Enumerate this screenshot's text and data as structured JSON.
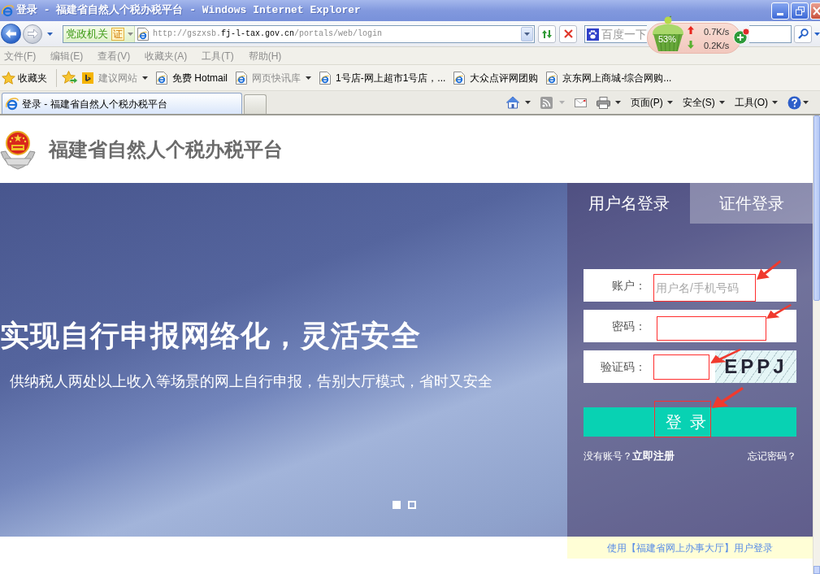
{
  "window": {
    "title": "登录 - 福建省自然人个税办税平台 - Windows Internet Explorer"
  },
  "address_bar": {
    "zone_label": "党政机关",
    "zone_badge": "证",
    "url_start": "http://gszxsb.",
    "url_domain": "fj-l-tax.gov.cn",
    "url_path": "/portals/web/login"
  },
  "search": {
    "placeholder": "百度一下"
  },
  "net_monitor": {
    "percent": "53%",
    "upload": "0.7K/s",
    "download": "0.2K/s"
  },
  "menu": [
    "文件(F)",
    "编辑(E)",
    "查看(V)",
    "收藏夹(A)",
    "工具(T)",
    "帮助(H)"
  ],
  "favorites_bar": {
    "label": "收藏夹",
    "items": [
      {
        "kind": "suggested",
        "label": "建议网站"
      },
      {
        "kind": "link",
        "label": "免费 Hotmail"
      },
      {
        "kind": "gallery",
        "label": "网页快讯库"
      },
      {
        "kind": "link",
        "label": "1号店-网上超市1号店，..."
      },
      {
        "kind": "link",
        "label": "大众点评网团购"
      },
      {
        "kind": "link",
        "label": "京东网上商城-综合网购..."
      }
    ]
  },
  "tabs": [
    {
      "label": "登录 - 福建省自然人个税办税平台",
      "selected": true
    }
  ],
  "command_bar": [
    "页面(P)",
    "安全(S)",
    "工具(O)"
  ],
  "page": {
    "site_title": "福建省自然人个税办税平台",
    "banner": {
      "headline": "实现自行申报网络化，灵活安全",
      "subline": "供纳税人两处以上收入等场景的网上自行申报，告别大厅模式，省时又安全",
      "slides": [
        {
          "selected": true
        },
        {
          "selected": false
        }
      ]
    },
    "login": {
      "tabs": [
        {
          "label": "用户名登录",
          "selected": true
        },
        {
          "label": "证件登录",
          "selected": false
        }
      ],
      "fields": [
        {
          "kind": "text",
          "label": "账户：",
          "placeholder": "用户名/手机号码"
        },
        {
          "kind": "password",
          "label": "密码："
        },
        {
          "kind": "captcha",
          "label": "验证码：",
          "captcha": "EPPJ"
        }
      ],
      "submit": "登 录",
      "register_prompt": "没有账号？",
      "register_link": "立即注册",
      "forgot_link": "忘记密码？",
      "alt_login_link": "使用【福建省网上办事大厅】用户登录"
    }
  }
}
